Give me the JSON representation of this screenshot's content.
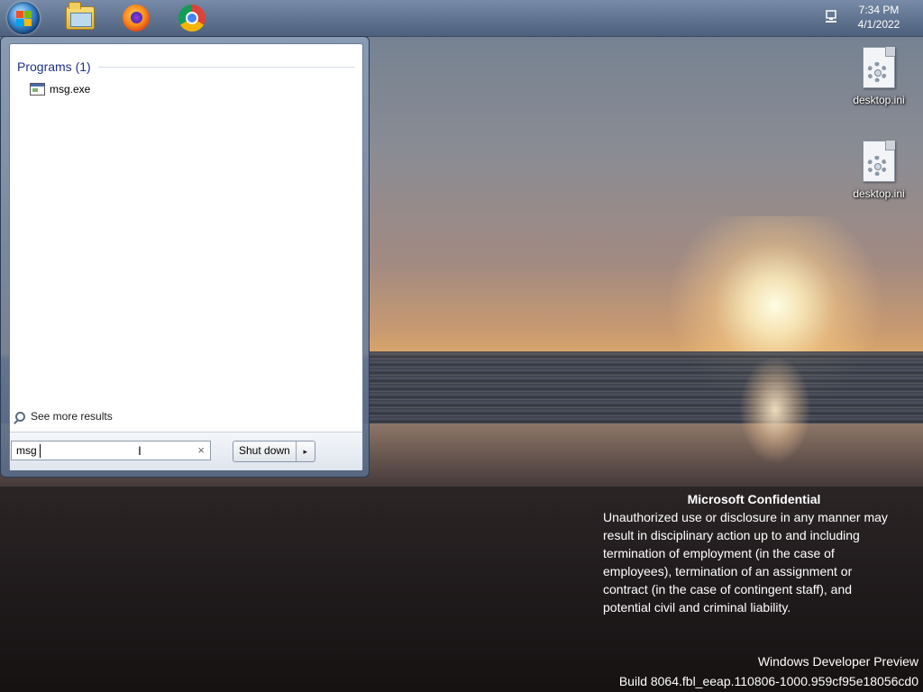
{
  "taskbar": {
    "pinned": [
      {
        "name": "start-orb",
        "icon": "windows-logo-icon"
      },
      {
        "name": "windows-explorer",
        "icon": "folder-icon"
      },
      {
        "name": "firefox",
        "icon": "firefox-icon"
      },
      {
        "name": "chrome",
        "icon": "chrome-icon"
      }
    ],
    "tray": {
      "network_icon": "network-icon"
    },
    "clock": {
      "time": "7:34 PM",
      "date": "4/1/2022"
    }
  },
  "desktop": {
    "icons": [
      {
        "label": "desktop.ini",
        "icon": "settings-file-icon"
      },
      {
        "label": "desktop.ini",
        "icon": "settings-file-icon"
      }
    ],
    "watermark": {
      "title": "Microsoft Confidential",
      "body": "Unauthorized use or disclosure in any manner may\nresult in disciplinary action up to and including\ntermination of employment (in the case of\nemployees), termination of an assignment or\ncontract (in the case of contingent staff), and\npotential civil and criminal liability.",
      "edition": "Windows Developer Preview",
      "build": "Build 8064.fbl_eeap.110806-1000.959cf95e18056cd0"
    }
  },
  "start_menu": {
    "programs_header": "Programs (1)",
    "results": [
      {
        "label": "msg.exe",
        "icon": "application-icon"
      }
    ],
    "see_more": "See more results",
    "search": {
      "value": "msg",
      "clear_icon": "×"
    },
    "shutdown": {
      "label": "Shut down",
      "arrow": "▸"
    }
  }
}
